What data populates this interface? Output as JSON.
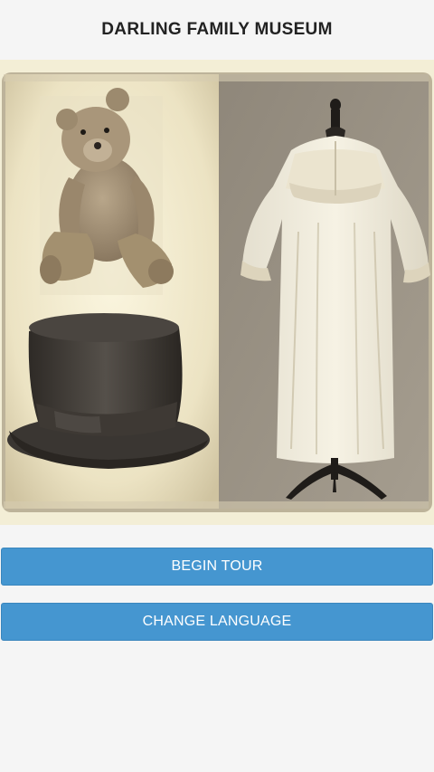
{
  "header": {
    "title": "DARLING FAMILY MUSEUM"
  },
  "hero": {
    "alt": "Teddy bear, top hat and white nightgown collage"
  },
  "buttons": {
    "begin_tour": "BEGIN TOUR",
    "change_language": "CHANGE LANGUAGE"
  },
  "colors": {
    "button_bg": "#4596d0",
    "button_text": "#ffffff",
    "page_bg": "#f5f5f5",
    "title_text": "#222222"
  }
}
